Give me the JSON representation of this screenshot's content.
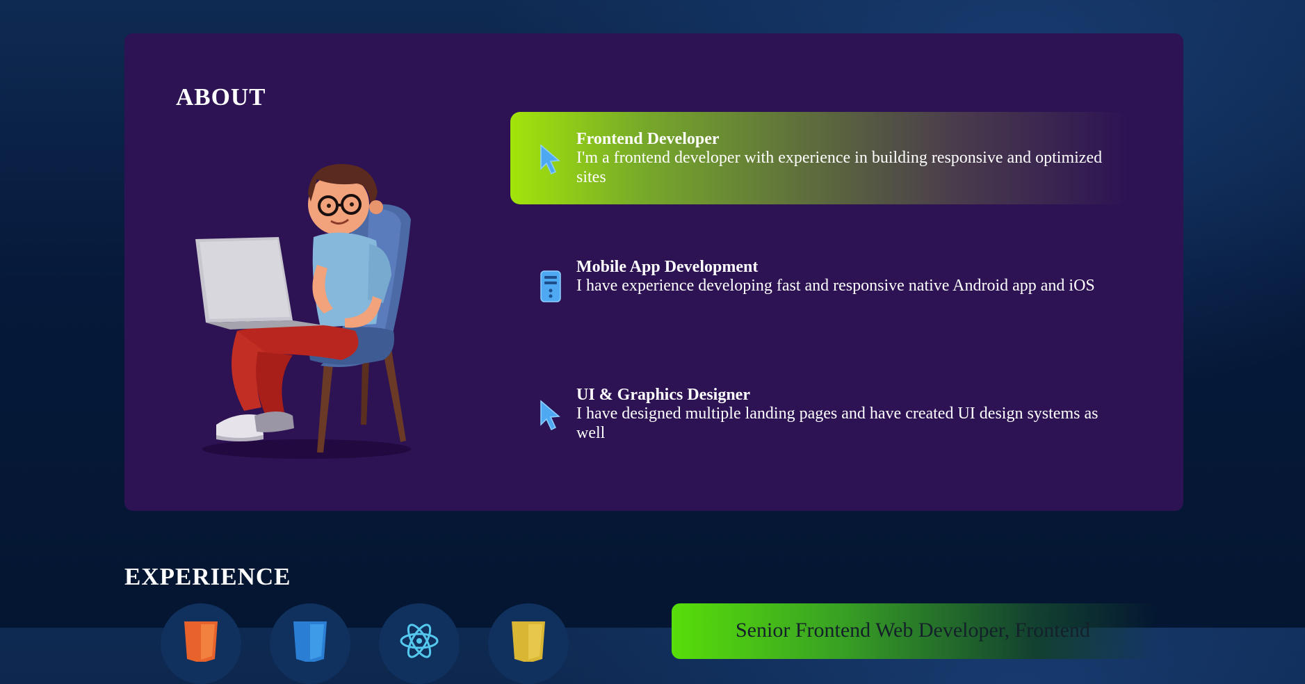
{
  "about": {
    "title": "ABOUT",
    "services": [
      {
        "title": "Frontend Developer",
        "description": "I'm a frontend developer with experience in building responsive and optimized sites",
        "icon": "cursor-arrow-icon",
        "active": true
      },
      {
        "title": "Mobile App Development",
        "description": "I have experience developing fast and responsive native Android app and iOS",
        "icon": "server-icon",
        "active": false
      },
      {
        "title": "UI & Graphics Designer",
        "description": "I have designed multiple landing pages and have created UI design systems as well",
        "icon": "cursor-arrow-icon",
        "active": false
      }
    ]
  },
  "experience": {
    "title": "EXPERIENCE",
    "tech_icons": [
      "html5-icon",
      "css3-icon",
      "react-icon",
      "javascript-icon"
    ],
    "job_title": "Senior Frontend Web Developer, Frontend"
  },
  "colors": {
    "card_background": "#2d1354",
    "accent_green": "#a3e40b",
    "icon_blue": "#4fa9f2",
    "page_background": "#06193a"
  }
}
